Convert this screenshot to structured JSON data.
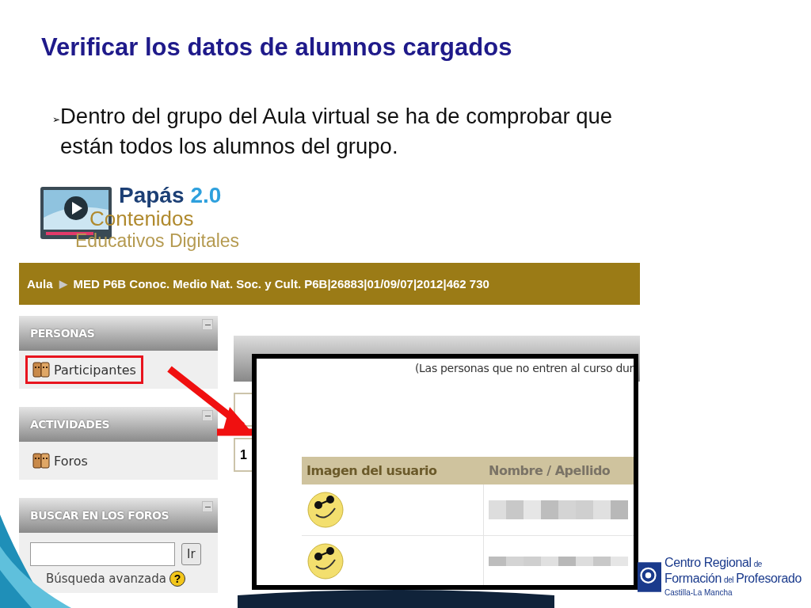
{
  "title": "Verificar los datos de alumnos cargados",
  "bullets": [
    {
      "marker": "➢",
      "text": "Dentro del grupo del Aula virtual se ha de comprobar que están todos los alumnos del grupo."
    }
  ],
  "logo": {
    "name": "Papás",
    "version": "2.0",
    "line_1": "Contenidos",
    "line_2": "Educativos Digitales"
  },
  "breadcrumb": {
    "items": [
      "Aula",
      "MED P6B Conoc. Medio Nat. Soc. y Cult. P6B|26883|01/09/07|2012|462 730"
    ],
    "separator": "▶"
  },
  "sidebar": [
    {
      "kind": "links",
      "title": "PERSONAS",
      "items": [
        {
          "label": "Participantes",
          "highlighted": true
        }
      ]
    },
    {
      "kind": "links",
      "title": "ACTIVIDADES",
      "items": [
        {
          "label": "Foros",
          "highlighted": false
        }
      ]
    },
    {
      "kind": "search",
      "title": "BUSCAR EN LOS FOROS",
      "button": "Ir",
      "link": "Búsqueda avanzada",
      "help": "?"
    }
  ],
  "main": {
    "page_box": "1"
  },
  "popup": {
    "note": "(Las personas que no entren al curso dur",
    "columns": [
      "Imagen del usuario",
      "Nombre / Apellido"
    ],
    "rows": [
      {
        "kind": "user"
      },
      {
        "kind": "user"
      }
    ]
  },
  "footer_logo": {
    "line_1": "Centro Regional",
    "line_1_small": "de",
    "line_2": "Formación",
    "line_2_small": "del",
    "line_2_end": "Profesorado",
    "line_3": "Castilla-La Mancha"
  }
}
